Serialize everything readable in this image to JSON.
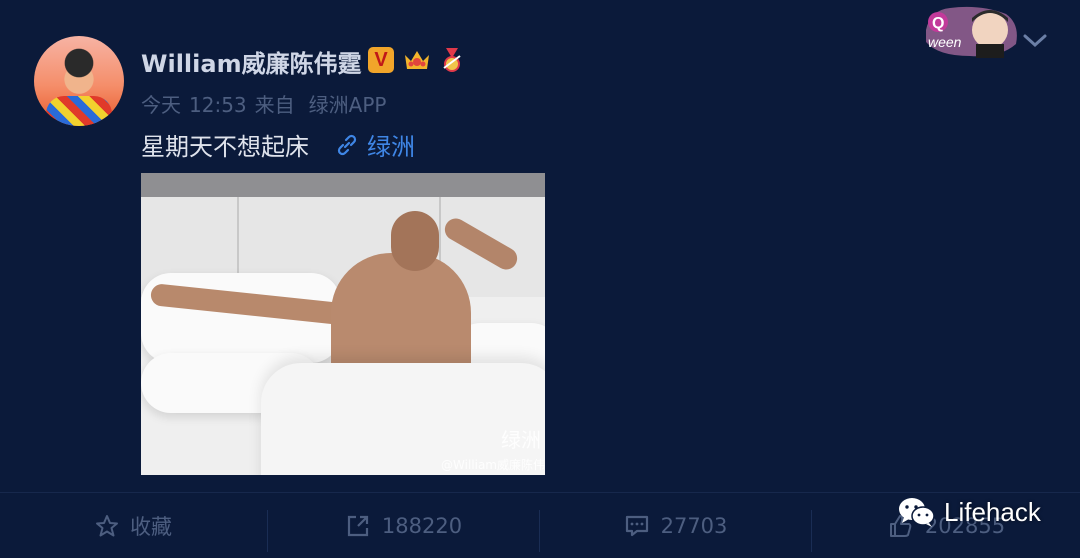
{
  "post": {
    "username": "William威廉陈伟霆",
    "badge_v": "V",
    "meta": {
      "date": "今天",
      "time": "12:53",
      "from": "来自",
      "source": "绿洲APP"
    },
    "text": "星期天不想起床",
    "link_label": "绿洲",
    "image_watermark": "绿洲",
    "image_credit": "@William威廉陈伟"
  },
  "actions": {
    "favorite_label": "收藏",
    "repost_count": "188220",
    "comment_count": "27703",
    "like_count": "202855"
  },
  "overlay": {
    "brand": "Lifehack",
    "decoration_text": "ween"
  },
  "colors": {
    "background": "#0b1a3a",
    "link": "#3f86e6",
    "muted": "#4d5e80"
  },
  "icons": [
    "chevron-down-icon",
    "link-icon",
    "star-icon",
    "repost-icon",
    "comment-icon",
    "thumb-up-icon",
    "wechat-icon",
    "crown-icon",
    "medal-icon"
  ]
}
